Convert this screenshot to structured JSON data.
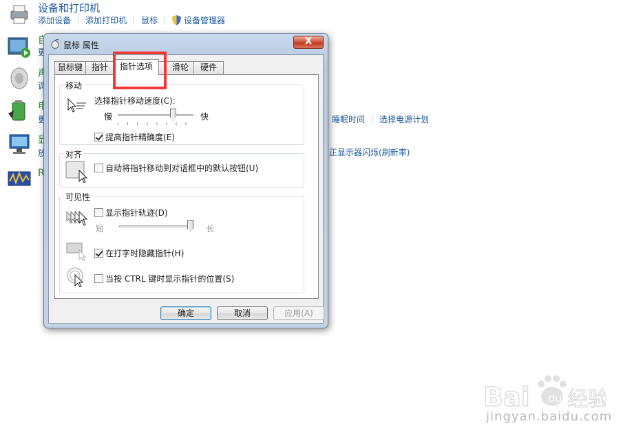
{
  "control_panel": {
    "devices": {
      "title": "设备和打印机",
      "links": [
        "添加设备",
        "添加打印机",
        "鼠标",
        "设备管理器"
      ]
    },
    "partial_rows": [
      {
        "char": "自",
        "sub": "更"
      },
      {
        "char": "声",
        "sub": "调"
      },
      {
        "char": "电",
        "sub": "更"
      },
      {
        "char": "显",
        "sub": "放"
      },
      {
        "char": "R",
        "sub": ""
      }
    ],
    "power_links": [
      "睡眠时间",
      "选择电源计划"
    ],
    "display_link": "正显示器闪烁(刷新率)"
  },
  "dialog": {
    "title": "鼠标 属性",
    "close_label": "X",
    "tabs": [
      {
        "label": "鼠标键",
        "active": false
      },
      {
        "label": "指针",
        "active": false
      },
      {
        "label": "指针选项",
        "active": true
      },
      {
        "label": "滑轮",
        "active": false
      },
      {
        "label": "硬件",
        "active": false
      }
    ],
    "motion": {
      "group_label": "移动",
      "speed_label": "选择指针移动速度(C):",
      "slow": "慢",
      "fast": "快",
      "speed_level": 0.75,
      "precision_label": "提高指针精确度(E)",
      "precision_checked": true
    },
    "snap": {
      "group_label": "对齐",
      "snap_label": "自动将指针移动到对话框中的默认按钮(U)",
      "snap_checked": false
    },
    "visibility": {
      "group_label": "可见性",
      "trails_label": "显示指针轨迹(D)",
      "trails_checked": false,
      "short": "短",
      "long": "长",
      "trail_level": 1.0,
      "hide_label": "在打字时隐藏指针(H)",
      "hide_checked": true,
      "ctrl_label": "当按 CTRL 键时显示指针的位置(S)",
      "ctrl_checked": false
    },
    "buttons": {
      "ok": "确定",
      "cancel": "取消",
      "apply": "应用(A)"
    }
  },
  "watermark": {
    "url": "jingyan.baidu.com",
    "brand": "Baidu经验"
  }
}
